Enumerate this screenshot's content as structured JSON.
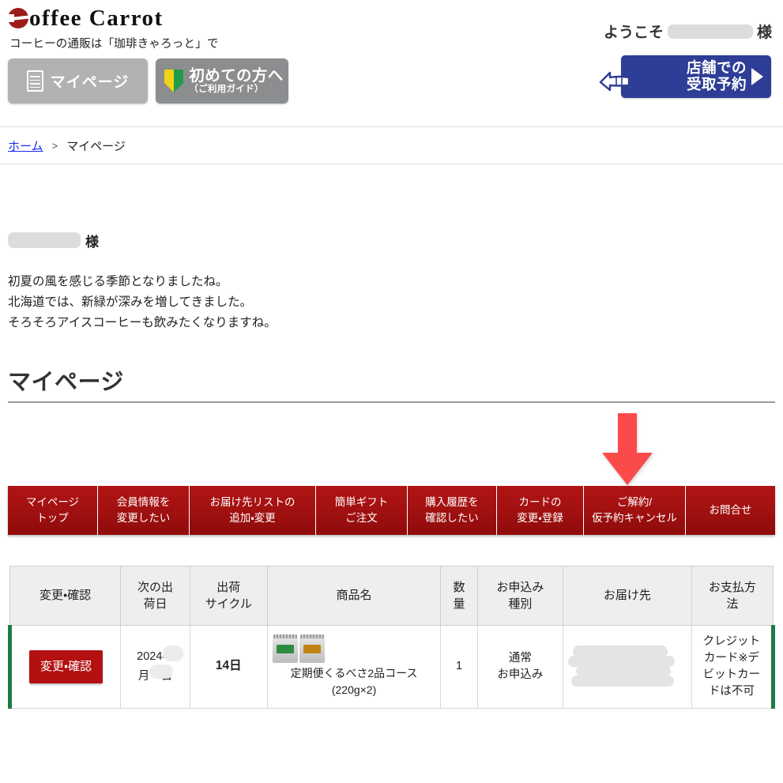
{
  "header": {
    "logo_text": "offee Carrot",
    "tagline": "コーヒーの通販は「珈琲きゃろっと」で",
    "mypage_button": "マイページ",
    "guide_button_main": "初めての方へ",
    "guide_button_sub": "（ご利用ガイド）",
    "welcome_prefix": "ようこそ",
    "welcome_suffix": "様",
    "reserve_line1": "店舗での",
    "reserve_line2": "受取予約"
  },
  "breadcrumb": {
    "home": "ホーム",
    "separator": ">",
    "current": "マイページ"
  },
  "greeting": {
    "name_suffix": "様",
    "line1": "初夏の風を感じる季節となりましたね。",
    "line2": "北海道では、新緑が深みを増してきました。",
    "line3": "そろそろアイスコーヒーも飲みたくなりますね。"
  },
  "page_title": "マイページ",
  "nav_tabs": [
    {
      "line1": "マイページ",
      "line2": "トップ"
    },
    {
      "line1": "会員情報を",
      "line2": "変更したい"
    },
    {
      "line1": "お届け先リストの",
      "line2": "追加・変更"
    },
    {
      "line1": "簡単ギフト",
      "line2": "ご注文"
    },
    {
      "line1": "購入履歴を",
      "line2": "確認したい"
    },
    {
      "line1": "カードの",
      "line2": "変更・登録"
    },
    {
      "line1": "ご解約/",
      "line2": "仮予約キャンセル"
    },
    {
      "line1": "お問合せ",
      "line2": ""
    }
  ],
  "table": {
    "headers": [
      {
        "line1": "変更・確認",
        "line2": ""
      },
      {
        "line1": "次の出",
        "line2": "荷日"
      },
      {
        "line1": "出荷",
        "line2": "サイクル"
      },
      {
        "line1": "商品名",
        "line2": ""
      },
      {
        "line1": "数",
        "line2": "量"
      },
      {
        "line1": "お申込み",
        "line2": "種別"
      },
      {
        "line1": "お届け先",
        "line2": ""
      },
      {
        "line1": "お支払方",
        "line2": "法"
      }
    ],
    "rows": [
      {
        "action_label": "変更・確認",
        "next_ship_line1": "2024年",
        "next_ship_line2": "月　日",
        "cycle": "14日",
        "product_name": "定期便くるべさ2品コース",
        "product_size": "(220g×2)",
        "quantity": "1",
        "order_type_line1": "通常",
        "order_type_line2": "お申込み",
        "destination": "",
        "payment_line1": "クレジット",
        "payment_line2": "カード※デ",
        "payment_line3": "ビットカー",
        "payment_line4": "ドは不可"
      }
    ]
  },
  "colors": {
    "brand_red": "#b11414",
    "nav_tab_red": "#a01010",
    "reserve_blue": "#2e3d95",
    "arrow_red": "#fb4a4a",
    "row_accent_green": "#1f7a45",
    "link_blue": "#1a2af0"
  }
}
